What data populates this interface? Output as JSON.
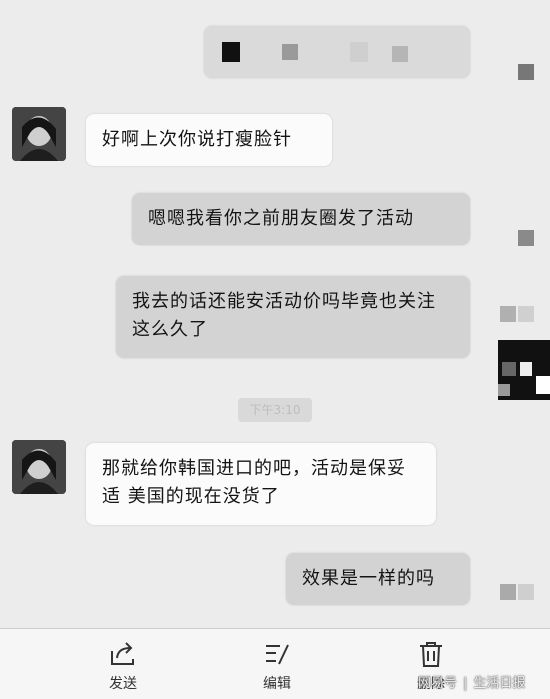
{
  "chat": {
    "messages": [
      {
        "from": "contact",
        "text": "好啊上次你说打瘦脸针"
      },
      {
        "from": "self",
        "text": "嗯嗯我看你之前朋友圈发了活动"
      },
      {
        "from": "self",
        "text": "我去的话还能安活动价吗毕竟也关注这么久了"
      },
      {
        "from": "contact",
        "text": "那就给你韩国进口的吧，活动是保妥适 美国的现在没货了"
      },
      {
        "from": "self",
        "text": "效果是一样的吗"
      }
    ],
    "timestamp": "下午3:10"
  },
  "toolbar": {
    "send_label": "发送",
    "edit_label": "编辑",
    "delete_label": "删除",
    "send_icon": "share-icon",
    "edit_icon": "edit-icon",
    "delete_icon": "trash-icon"
  },
  "watermark": {
    "source": "网易号",
    "brand": "生活日报"
  }
}
